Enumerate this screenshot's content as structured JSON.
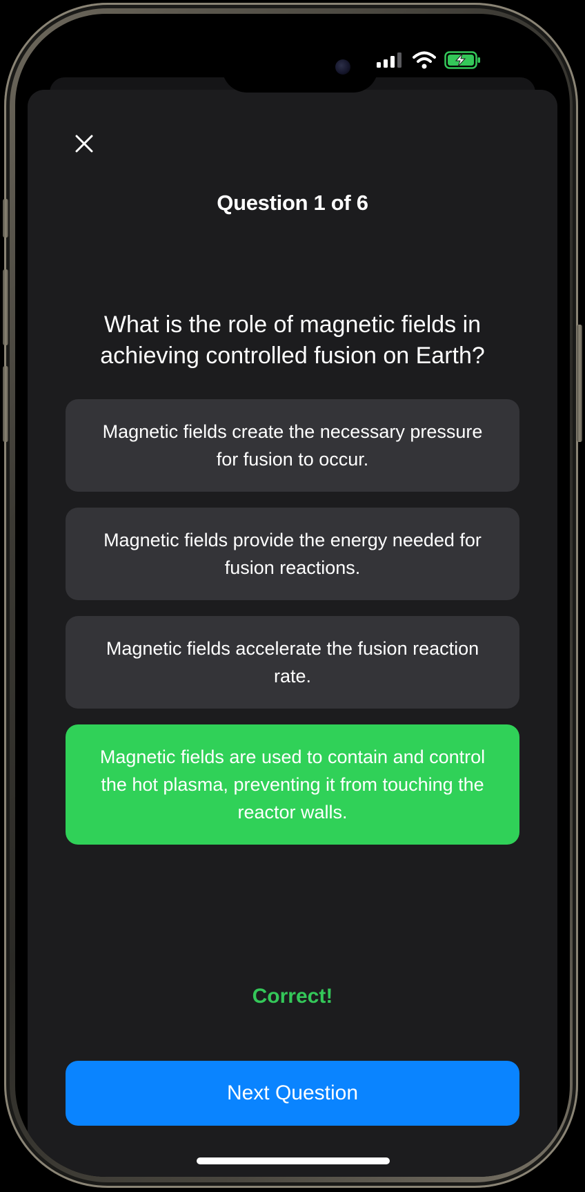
{
  "status_bar": {
    "signal_icon": "cellular-signal-icon",
    "wifi_icon": "wifi-icon",
    "battery_icon": "battery-charging-icon",
    "battery_color": "#34c759"
  },
  "quiz": {
    "close_icon": "close-icon",
    "counter": "Question 1 of 6",
    "question": "What is the role of magnetic fields in achieving controlled fusion on Earth?",
    "answers": [
      {
        "label": "Magnetic fields create the necessary pressure for fusion to occur.",
        "state": "default"
      },
      {
        "label": "Magnetic fields provide the energy needed for fusion reactions.",
        "state": "default"
      },
      {
        "label": "Magnetic fields accelerate the fusion reaction rate.",
        "state": "default"
      },
      {
        "label": "Magnetic fields are used to contain and control the hot plasma, preventing it from touching the reactor walls.",
        "state": "correct"
      }
    ],
    "feedback": "Correct!",
    "next_button_label": "Next Question"
  },
  "colors": {
    "background": "#1c1c1e",
    "answer_default": "#343438",
    "answer_correct": "#30d158",
    "feedback_text": "#34c759",
    "primary_button": "#0a84ff"
  }
}
